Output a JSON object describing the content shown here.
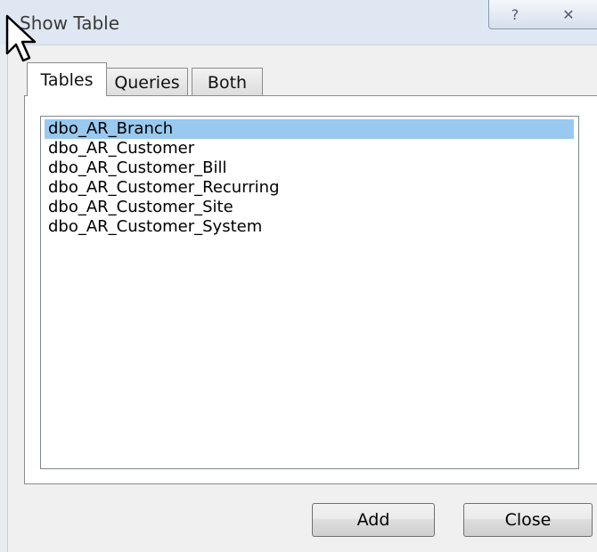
{
  "window": {
    "title": "Show Table",
    "help_glyph": "?",
    "close_glyph": "✕"
  },
  "tabs": [
    {
      "label": "Tables",
      "selected": true
    },
    {
      "label": "Queries",
      "selected": false
    },
    {
      "label": "Both",
      "selected": false
    }
  ],
  "table_list": {
    "items": [
      {
        "label": "dbo_AR_Branch",
        "selected": true
      },
      {
        "label": "dbo_AR_Customer",
        "selected": false
      },
      {
        "label": "dbo_AR_Customer_Bill",
        "selected": false
      },
      {
        "label": "dbo_AR_Customer_Recurring",
        "selected": false
      },
      {
        "label": "dbo_AR_Customer_Site",
        "selected": false
      },
      {
        "label": "dbo_AR_Customer_System",
        "selected": false
      }
    ]
  },
  "buttons": {
    "add_label": "Add",
    "close_label": "Close"
  },
  "colors": {
    "selection": "#99c9ef",
    "titlebar": "#dfe8f2"
  },
  "icons": [
    "help-icon",
    "close-icon",
    "mouse-pointer-icon"
  ]
}
